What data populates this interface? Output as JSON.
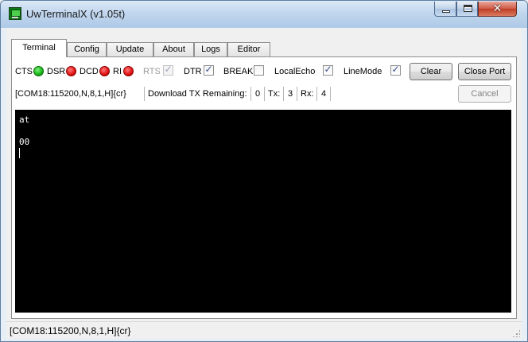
{
  "window": {
    "title": "UwTerminalX (v1.05t)",
    "controls": [
      "minimize",
      "maximize",
      "close"
    ]
  },
  "tabs": [
    {
      "label": "Terminal",
      "active": true
    },
    {
      "label": "Config",
      "active": false
    },
    {
      "label": "Update",
      "active": false
    },
    {
      "label": "About",
      "active": false
    },
    {
      "label": "Logs",
      "active": false
    },
    {
      "label": "Editor",
      "active": false
    }
  ],
  "signals": {
    "cts": {
      "label": "CTS",
      "state": "green"
    },
    "dsr": {
      "label": "DSR",
      "state": "red"
    },
    "dcd": {
      "label": "DCD",
      "state": "red"
    },
    "ri": {
      "label": "RI",
      "state": "red"
    }
  },
  "checkboxes": {
    "rts": {
      "label": "RTS",
      "checked": true,
      "enabled": false
    },
    "dtr": {
      "label": "DTR",
      "checked": true,
      "enabled": true
    },
    "break": {
      "label": "BREAK",
      "checked": false,
      "enabled": true
    },
    "localecho": {
      "label": "LocalEcho",
      "checked": true,
      "enabled": true
    },
    "linemode": {
      "label": "LineMode",
      "checked": true,
      "enabled": true
    }
  },
  "buttons": {
    "clear": "Clear",
    "close_port": "Close Port",
    "cancel": "Cancel"
  },
  "status": {
    "port_info": "[COM18:115200,N,8,1,H]{cr}",
    "download_label": "Download TX Remaining:",
    "download_value": "0",
    "tx_label": "Tx:",
    "tx_value": "3",
    "rx_label": "Rx:",
    "rx_value": "4"
  },
  "terminal": {
    "lines": [
      "at",
      "",
      "00"
    ]
  },
  "statusbar": {
    "text": "[COM18:115200,N,8,1,H]{cr}"
  },
  "colors": {
    "led_green": "#16b416",
    "led_red": "#e01010",
    "terminal_bg": "#000000",
    "terminal_fg": "#ffffff",
    "close_button": "#c13d26"
  }
}
